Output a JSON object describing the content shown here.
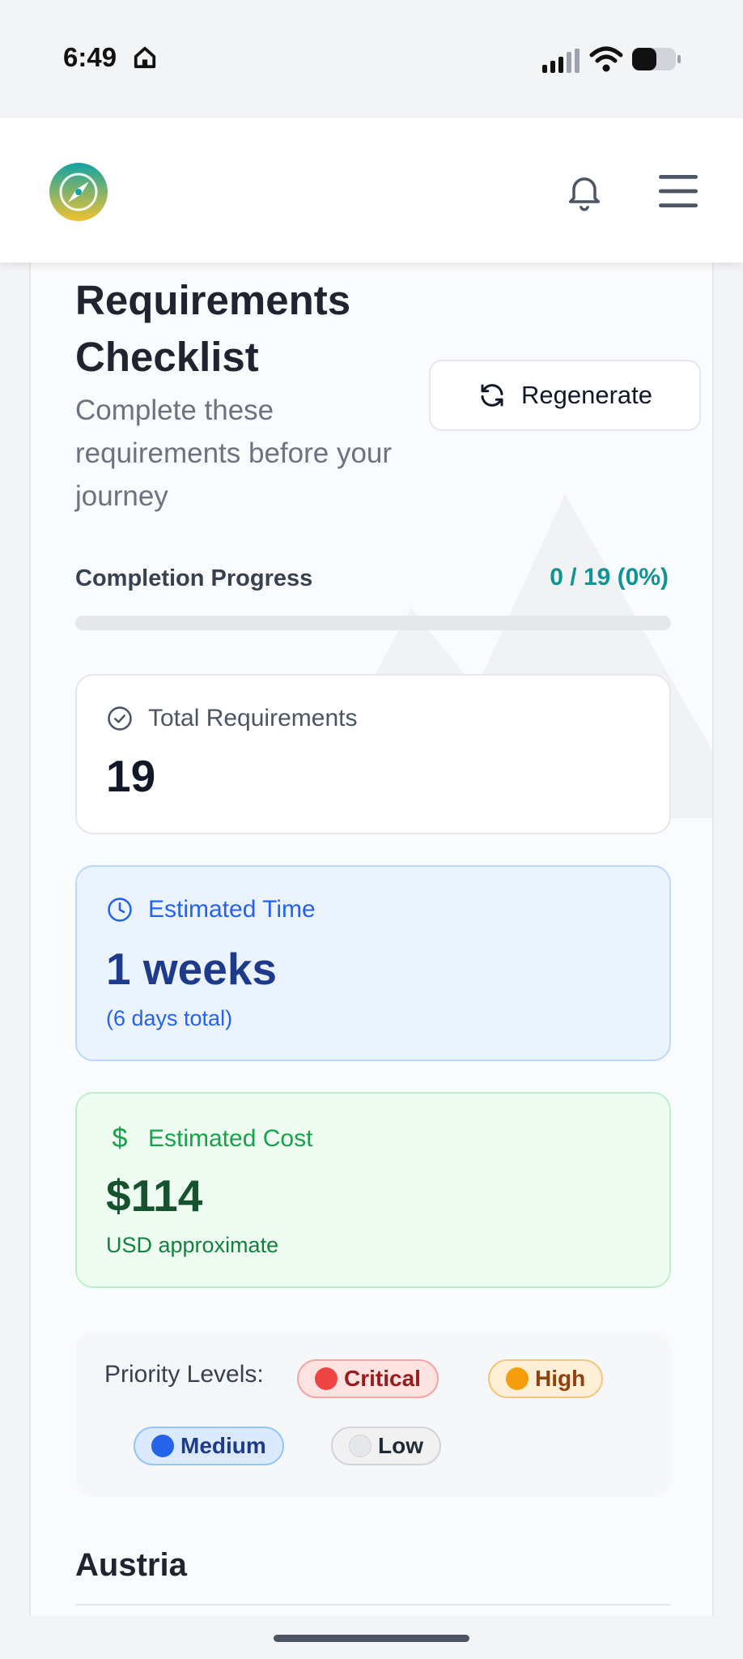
{
  "status_bar": {
    "time": "6:49"
  },
  "header": {},
  "page": {
    "title": "Requirements Checklist",
    "subtitle": "Complete these requirements before your journey",
    "regenerate_label": "Regenerate"
  },
  "progress": {
    "label": "Completion Progress",
    "value_text": "0 / 19 (0%)",
    "fraction": 0
  },
  "stats": {
    "total": {
      "label": "Total Requirements",
      "value": "19"
    },
    "time": {
      "label": "Estimated Time",
      "value": "1 weeks",
      "note": "(6 days total)"
    },
    "cost": {
      "label": "Estimated Cost",
      "value": "$114",
      "note": "USD approximate",
      "currency_symbol": "$"
    }
  },
  "priority": {
    "label": "Priority Levels:",
    "levels": [
      {
        "label": "Critical",
        "color": "#ef4444"
      },
      {
        "label": "High",
        "color": "#f59e0b"
      },
      {
        "label": "Medium",
        "color": "#2563eb"
      },
      {
        "label": "Low",
        "color": "#e5e7eb"
      }
    ]
  },
  "section": {
    "title": "Austria"
  },
  "colors": {
    "accent": "#0f9494",
    "time_blue": "#2563eb",
    "cost_green": "#16a34a"
  }
}
